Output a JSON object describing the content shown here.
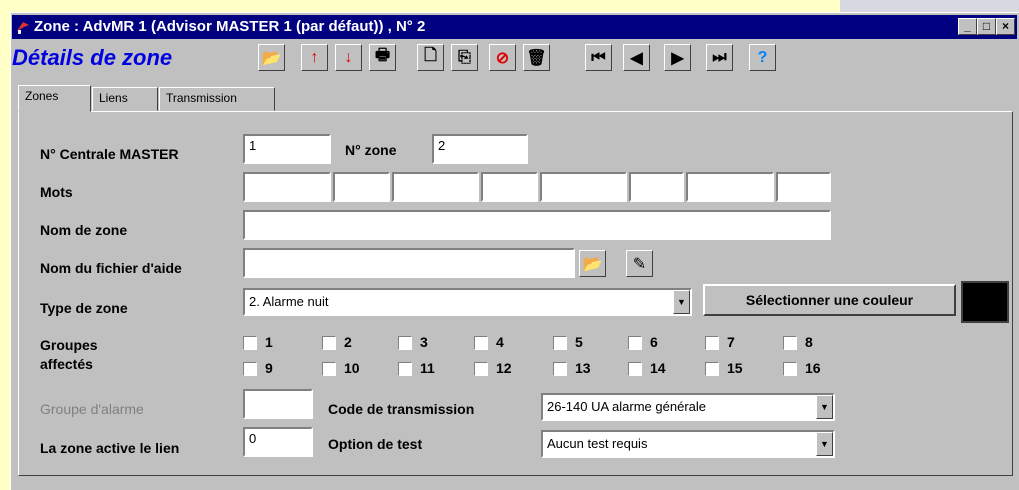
{
  "window": {
    "title": "Zone : AdvMR 1 (Advisor MASTER 1 (par défaut)) , N° 2",
    "min_glyph": "_",
    "max_glyph": "□",
    "close_glyph": "×"
  },
  "header": {
    "subtitle": "Détails de zone"
  },
  "toolbar": [
    {
      "icon": "folder-open-icon",
      "glyph": "📂"
    },
    {
      "icon": "arrow-up-icon",
      "glyph": "↑",
      "color": "#e00000"
    },
    {
      "icon": "arrow-down-icon",
      "glyph": "↓",
      "color": "#e00000"
    },
    {
      "icon": "print-icon",
      "glyph": "🖶"
    },
    {
      "icon": "new-doc-icon",
      "glyph": "🗋"
    },
    {
      "icon": "copy-icon",
      "glyph": "⎘"
    },
    {
      "icon": "cancel-icon",
      "glyph": "⊘",
      "color": "#e00000"
    },
    {
      "icon": "trash-icon",
      "glyph": "🗑"
    },
    {
      "icon": "first-icon",
      "glyph": "⏮"
    },
    {
      "icon": "prev-icon",
      "glyph": "◀"
    },
    {
      "icon": "next-icon",
      "glyph": "▶"
    },
    {
      "icon": "last-icon",
      "glyph": "⏭"
    },
    {
      "icon": "help-icon",
      "glyph": "?",
      "color": "#0080ff"
    }
  ],
  "tabs": [
    "Zones",
    "Liens",
    "Transmission"
  ],
  "form": {
    "centrale_label": "N° Centrale MASTER",
    "centrale_value": "1",
    "zone_label": "N° zone",
    "zone_value": "2",
    "mots_label": "Mots",
    "nom_zone_label": "Nom de zone",
    "nom_zone_value": "",
    "fichier_aide_label": "Nom du fichier d'aide",
    "fichier_aide_value": "",
    "type_zone_label": "Type de zone",
    "type_zone_value": "2. Alarme nuit",
    "select_color_label": "Sélectionner une couleur",
    "zone_color": "#000000",
    "groupes_label_1": "Groupes",
    "groupes_label_2": "affectés",
    "groupes": [
      "1",
      "2",
      "3",
      "4",
      "5",
      "6",
      "7",
      "8",
      "9",
      "10",
      "11",
      "12",
      "13",
      "14",
      "15",
      "16"
    ],
    "groupe_alarme_label": "Groupe d'alarme",
    "groupe_alarme_value": "",
    "code_transmission_label": "Code de transmission",
    "code_transmission_value": "26-140 UA alarme générale",
    "zone_active_label": "La zone active le lien",
    "zone_active_value": "0",
    "option_test_label": "Option de test",
    "option_test_value": "Aucun test requis"
  }
}
